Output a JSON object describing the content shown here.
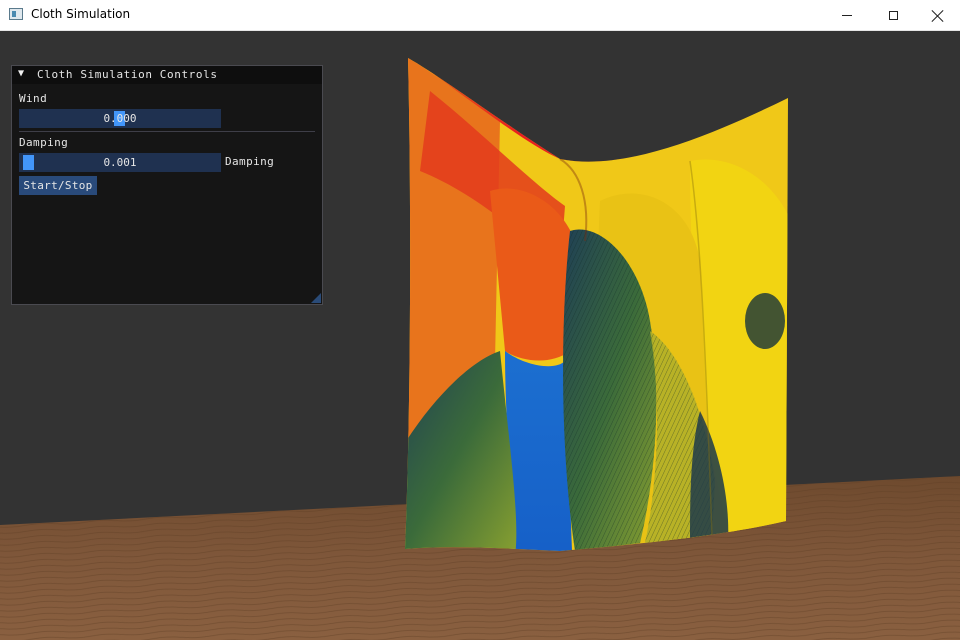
{
  "window": {
    "title": "Cloth Simulation",
    "icon": "app-window-icon",
    "controls": [
      "minimize-icon",
      "maximize-icon",
      "close-icon"
    ]
  },
  "panel": {
    "title": "Cloth Simulation Controls",
    "collapse_icon": "triangle-down-icon",
    "wind": {
      "label": "Wind",
      "value": "0.000"
    },
    "damping": {
      "label": "Damping",
      "value": "0.001",
      "side_label": "Damping"
    },
    "toggle_button": "Start/Stop"
  },
  "colors": {
    "viewport_background": "#333333",
    "panel_background": "#141414",
    "slider_background": "#1f3150",
    "slider_grab": "#4296fa",
    "button_background": "#294a7a",
    "floor_wood": "#7a5234",
    "cloth_red": "#e51e1e",
    "cloth_orange": "#f07a10",
    "cloth_yellow": "#f5d814",
    "cloth_blue": "#1e6ed8",
    "cloth_dark_green": "#2a4a3e"
  }
}
